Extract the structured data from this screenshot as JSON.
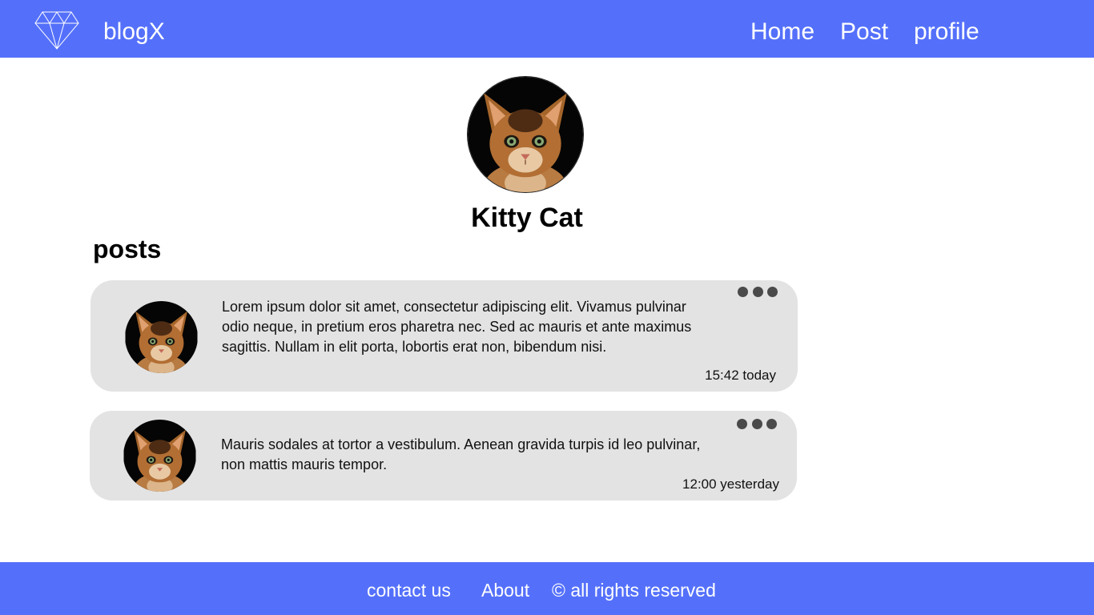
{
  "header": {
    "logo_icon": "diamond-icon",
    "brand": "blogX",
    "nav": {
      "home": "Home",
      "post": "Post",
      "profile": "profile"
    },
    "background_color": "#5470fb"
  },
  "profile": {
    "avatar": "cat-avatar",
    "name": "Kitty Cat"
  },
  "posts_section": {
    "heading": "posts",
    "items": [
      {
        "avatar": "cat-avatar",
        "text": "Lorem ipsum dolor sit amet, consectetur adipiscing elit. Vivamus pulvinar odio neque, in pretium eros pharetra nec. Sed ac mauris et ante maximus sagittis. Nullam in elit porta, lobortis erat non, bibendum nisi.",
        "time": "15:42 today",
        "menu_icon": "more-dots-icon"
      },
      {
        "avatar": "cat-avatar",
        "text": "Mauris sodales at tortor a vestibulum. Aenean gravida turpis id leo pulvinar, non mattis mauris tempor.",
        "time": "12:00 yesterday",
        "menu_icon": "more-dots-icon"
      }
    ]
  },
  "footer": {
    "contact": "contact us",
    "about": "About",
    "rights": "© all rights reserved"
  }
}
